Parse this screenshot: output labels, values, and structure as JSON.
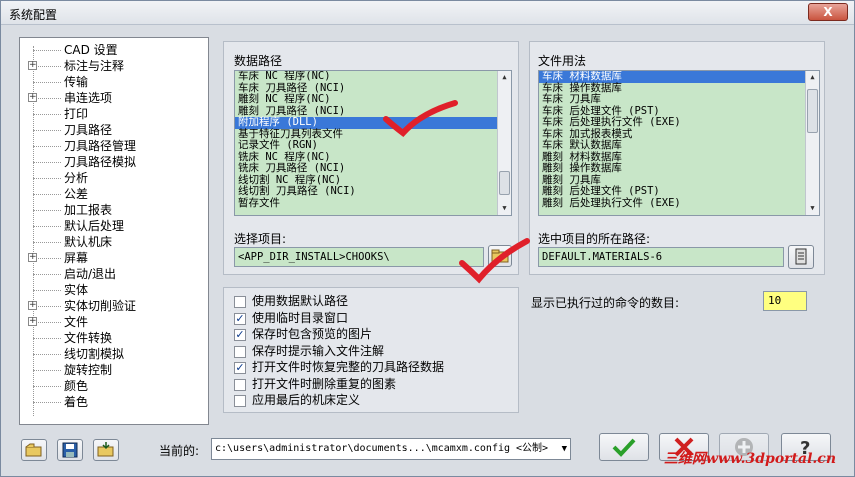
{
  "window": {
    "title": "系统配置",
    "close_label": "X"
  },
  "tree": {
    "items": [
      {
        "label": "CAD 设置",
        "expandable": false
      },
      {
        "label": "标注与注释",
        "expandable": true
      },
      {
        "label": "传输",
        "expandable": false
      },
      {
        "label": "串连选项",
        "expandable": true
      },
      {
        "label": "打印",
        "expandable": false
      },
      {
        "label": "刀具路径",
        "expandable": false
      },
      {
        "label": "刀具路径管理",
        "expandable": false
      },
      {
        "label": "刀具路径模拟",
        "expandable": false
      },
      {
        "label": "分析",
        "expandable": false
      },
      {
        "label": "公差",
        "expandable": false
      },
      {
        "label": "加工报表",
        "expandable": false
      },
      {
        "label": "默认后处理",
        "expandable": false
      },
      {
        "label": "默认机床",
        "expandable": false
      },
      {
        "label": "屏幕",
        "expandable": true
      },
      {
        "label": "启动/退出",
        "expandable": false
      },
      {
        "label": "实体",
        "expandable": false
      },
      {
        "label": "实体切削验证",
        "expandable": true
      },
      {
        "label": "文件",
        "expandable": true
      },
      {
        "label": "文件转换",
        "expandable": false
      },
      {
        "label": "线切割模拟",
        "expandable": false
      },
      {
        "label": "旋转控制",
        "expandable": false
      },
      {
        "label": "颜色",
        "expandable": false
      },
      {
        "label": "着色",
        "expandable": false
      }
    ]
  },
  "data_paths": {
    "title": "数据路径",
    "items": [
      "车床 NC 程序(NC)",
      "车床 刀具路径 (NCI)",
      "雕刻 NC 程序(NC)",
      "雕刻 刀具路径 (NCI)",
      "附加程序 (DLL)",
      "基于特征刀具列表文件",
      "记录文件 (RGN)",
      "铣床 NC 程序(NC)",
      "铣床 刀具路径 (NCI)",
      "线切割 NC 程序(NC)",
      "线切割 刀具路径 (NCI)",
      "暂存文件"
    ],
    "selected_index": 4,
    "select_item_label": "选择项目:",
    "select_item_value": "<APP_DIR_INSTALL>CHOOKS\\"
  },
  "file_usage": {
    "title": "文件用法",
    "items": [
      "车床 材料数据库",
      "车床 操作数据库",
      "车床 刀具库",
      "车床 后处理文件 (PST)",
      "车床 后处理执行文件 (EXE)",
      "车床 加式报表模式",
      "车床 默认数据库",
      "雕刻 材料数据库",
      "雕刻 操作数据库",
      "雕刻 刀具库",
      "雕刻 后处理文件 (PST)",
      "雕刻 后处理执行文件 (EXE)"
    ],
    "selected_index": 0,
    "path_label": "选中项目的所在路径:",
    "path_value": "DEFAULT.MATERIALS-6"
  },
  "options": [
    {
      "label": "使用数据默认路径",
      "checked": false
    },
    {
      "label": "使用临时目录窗口",
      "checked": true
    },
    {
      "label": "保存时包含预览的图片",
      "checked": true
    },
    {
      "label": "保存时提示输入文件注解",
      "checked": false
    },
    {
      "label": "打开文件时恢复完整的刀具路径数据",
      "checked": true
    },
    {
      "label": "打开文件时删除重复的图素",
      "checked": false
    },
    {
      "label": "应用最后的机床定义",
      "checked": false
    }
  ],
  "recent_commands": {
    "label": "显示已执行过的命令的数目:",
    "value": "10"
  },
  "bottom": {
    "current_label": "当前的:",
    "current_value": "c:\\users\\administrator\\documents...\\mcamxm.config <公制>",
    "watermark": "三维网www.3dportal.cn"
  },
  "colors": {
    "accent": "#3a78d8",
    "list_bg": "#c8e6c8",
    "ok_green": "#2aa02a",
    "cancel_red": "#d02020",
    "check_red": "#e0202a"
  }
}
